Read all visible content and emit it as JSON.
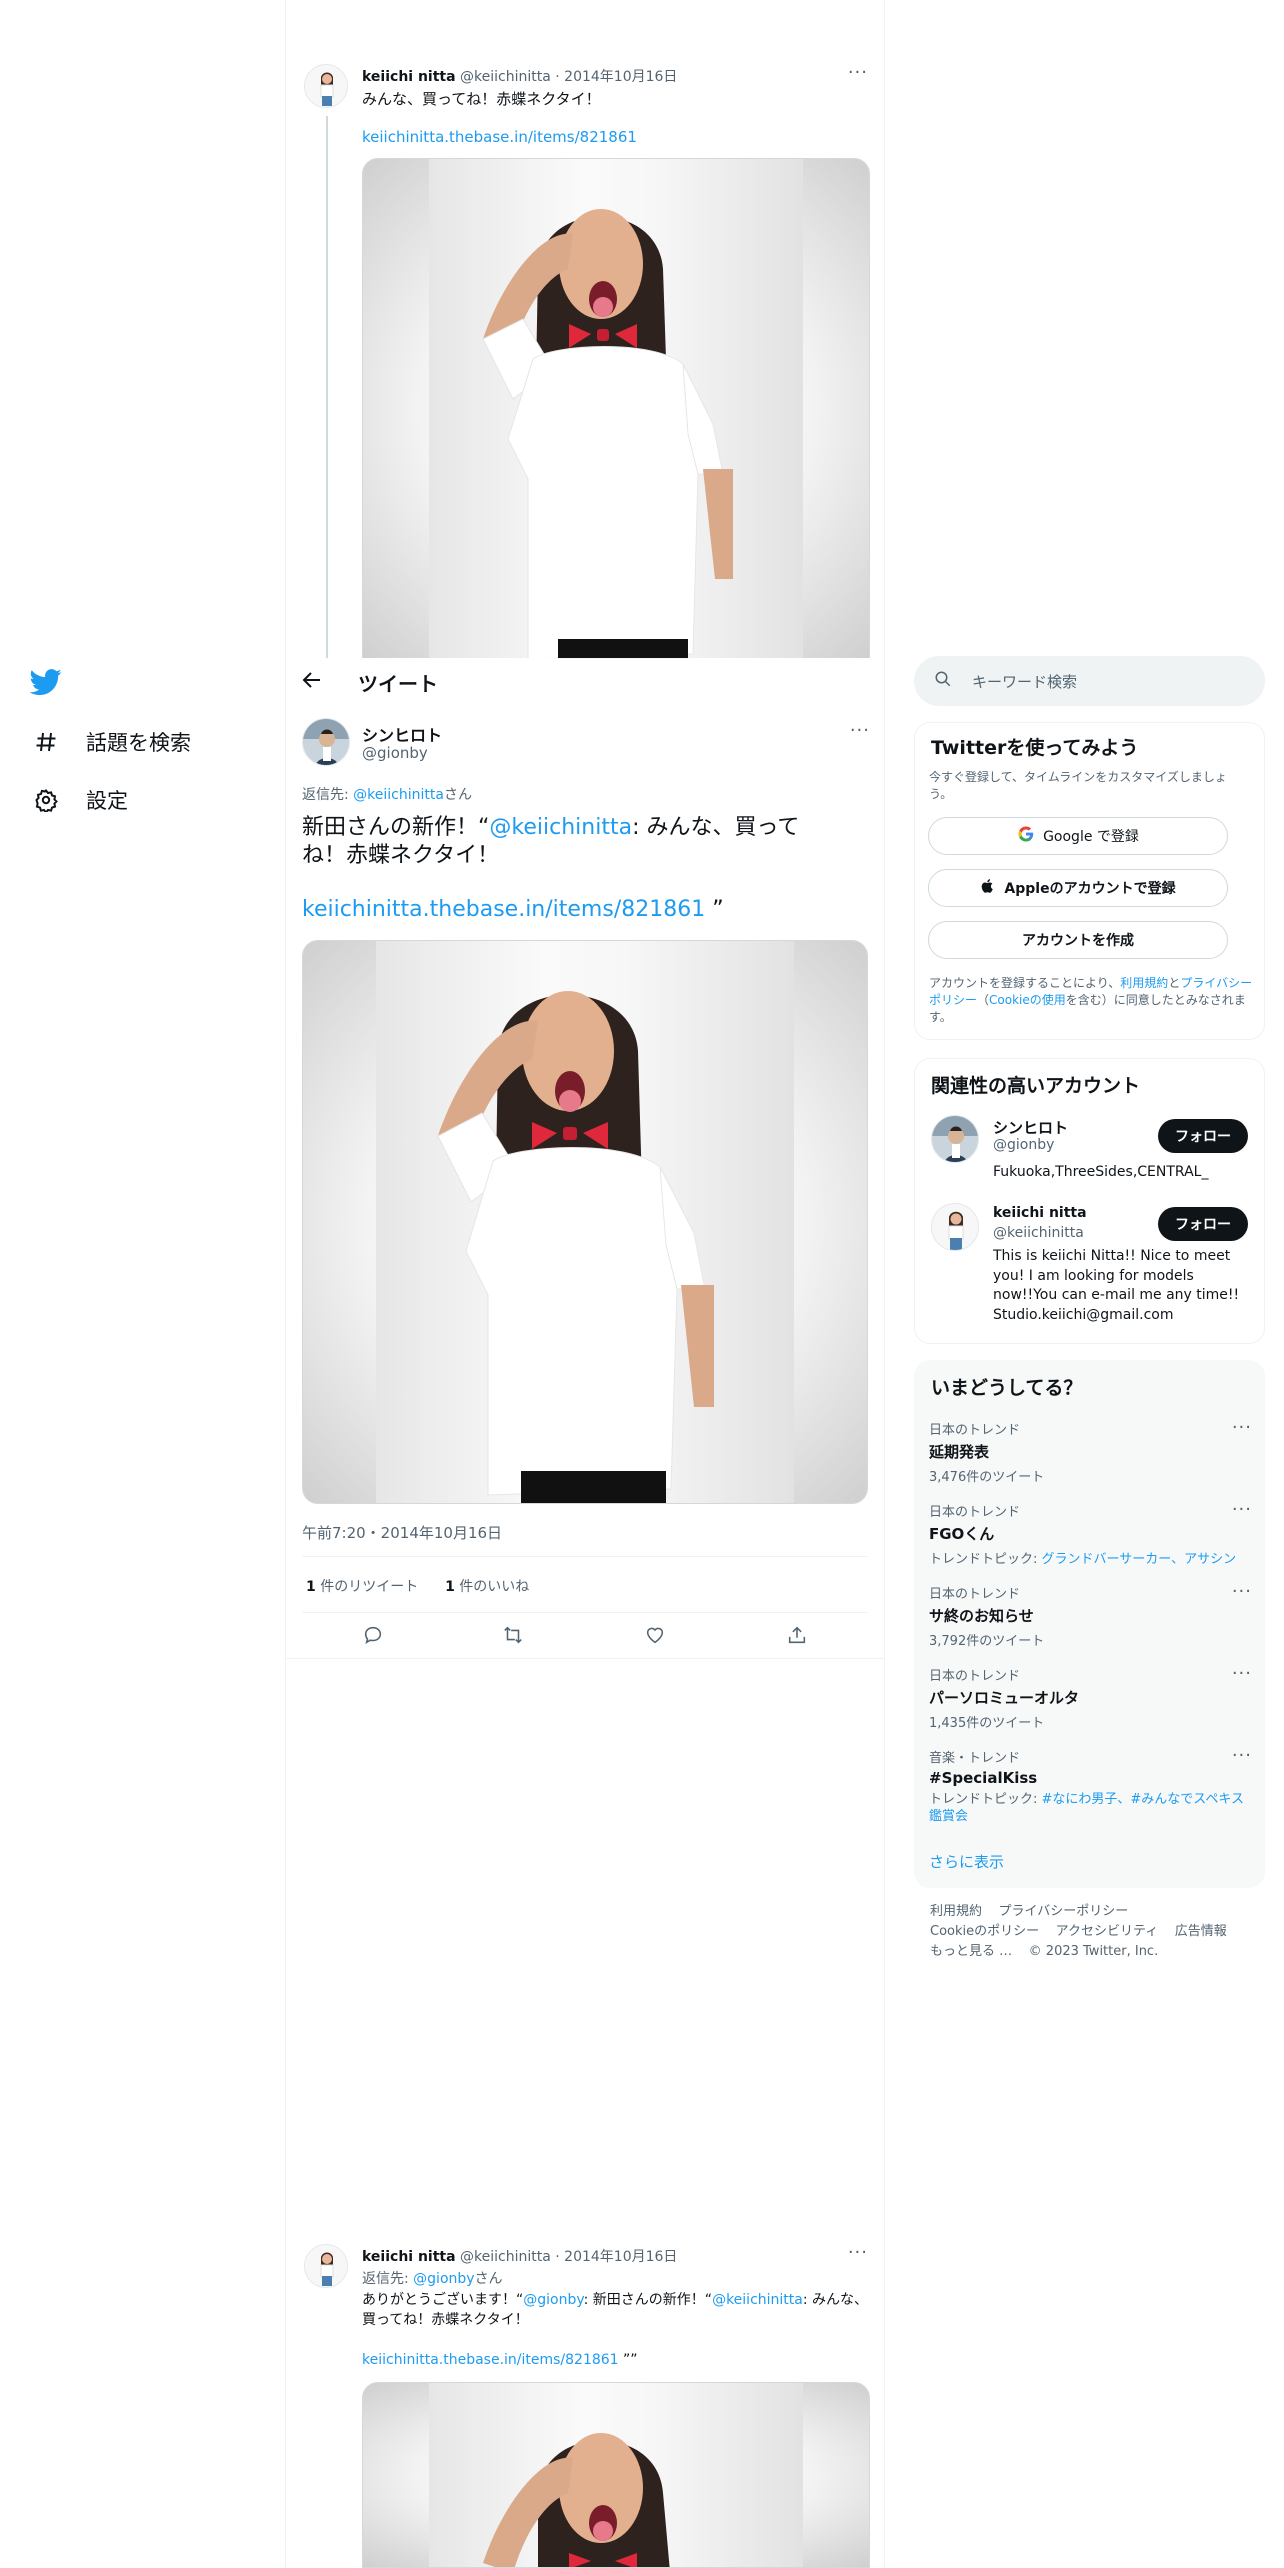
{
  "nav": {
    "items": [
      {
        "label": "話題を検索",
        "icon": "hashtag-icon"
      },
      {
        "label": "設定",
        "icon": "gear-icon"
      }
    ]
  },
  "top_tweet": {
    "name": "keiichi nitta",
    "handle": "@keiichinitta",
    "date": "2014年10月16日",
    "text": "みんな、買ってね！赤蝶ネクタイ！",
    "link": "keiichinitta.thebase.in/items/821861"
  },
  "header": {
    "title": "ツイート"
  },
  "main_tweet": {
    "name": "シンヒロト",
    "handle": "@gionby",
    "reply_prefix": "返信先: ",
    "reply_to": "@keiichinitta",
    "reply_suffix": "さん",
    "text_before": "新田さんの新作！“",
    "mention": "@keiichinitta",
    "text_after": ": みんな、買ってね！赤蝶ネクタイ！",
    "link": "keiichinitta.thebase.in/items/821861",
    "link_after": " ”",
    "timestamp": "午前7:20・2014年10月16日",
    "retweet_count": "1",
    "retweet_label": " 件のリツイート",
    "like_count": "1",
    "like_label": " 件のいいね"
  },
  "bottom_tweet": {
    "name": "keiichi nitta",
    "handle": "@keiichinitta",
    "date": "2014年10月16日",
    "reply_prefix": "返信先: ",
    "reply_to": "@gionby",
    "reply_suffix": "さん",
    "text_1": "ありがとうございます！“",
    "mention_1": "@gionby",
    "text_2": ": 新田さんの新作！“",
    "mention_2": "@keiichinitta",
    "text_3": ": みんな、買ってね！赤蝶ネクタイ！",
    "link": "keiichinitta.thebase.in/items/821861",
    "link_after": " ””"
  },
  "sidebar": {
    "search_placeholder": "キーワード検索",
    "signup": {
      "title": "Twitterを使ってみよう",
      "subtitle": "今すぐ登録して、タイムラインをカスタマイズしましょう。",
      "google_button": "Google で登録",
      "apple_button": "Appleのアカウントで登録",
      "create_button": "アカウントを作成",
      "terms_1": "アカウントを登録することにより、",
      "terms_link_1": "利用規約",
      "terms_2": "と",
      "terms_link_2": "プライバシーポリシー",
      "terms_3": "（",
      "terms_link_3": "Cookieの使用",
      "terms_4": "を含む）に同意したとみなされます。"
    },
    "related": {
      "title": "関連性の高いアカウント",
      "accounts": [
        {
          "name": "シンヒロト",
          "handle": "@gionby",
          "bio": "Fukuoka,ThreeSides,CENTRAL_",
          "follow": "フォロー"
        },
        {
          "name": "keiichi nitta",
          "handle": "@keiichinitta",
          "bio": "This is keiichi Nitta!! Nice to meet you! I am looking for models now!!You can e-mail me any time!! Studio.keiichi@gmail.com",
          "follow": "フォロー"
        }
      ]
    },
    "trends": {
      "title": "いまどうしてる？",
      "items": [
        {
          "category": "日本のトレンド",
          "name": "延期発表",
          "meta": "3,476件のツイート"
        },
        {
          "category": "日本のトレンド",
          "name": "FGOくん",
          "meta_prefix": "トレンドトピック: ",
          "meta_link": "グランドバーサーカー、アサシン"
        },
        {
          "category": "日本のトレンド",
          "name": "サ終のお知らせ",
          "meta": "3,792件のツイート"
        },
        {
          "category": "日本のトレンド",
          "name": "パーソロミューオルタ",
          "meta": "1,435件のツイート"
        },
        {
          "category": "音楽・トレンド",
          "name": "#SpecialKiss",
          "meta_prefix": "トレンドトピック: ",
          "meta_link": "#なにわ男子、#みんなでスペキス鑑賞会"
        }
      ],
      "show_more": "さらに表示"
    },
    "footer": {
      "links": [
        "利用規約",
        "プライバシーポリシー",
        "Cookieのポリシー",
        "アクセシビリティ",
        "広告情報",
        "もっと見る …"
      ],
      "copyright": "© 2023 Twitter, Inc."
    }
  },
  "colors": {
    "accent": "#1d9bf0",
    "text": "#0f1419",
    "muted": "#536471",
    "bowtie": "#e0283c"
  }
}
